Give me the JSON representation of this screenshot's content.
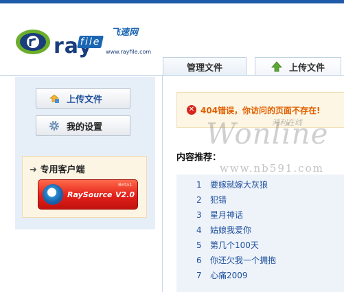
{
  "header": {
    "logo_brand": "ray",
    "logo_brand_file": "file",
    "logo_cn": "飞速网",
    "logo_url": "www.rayfile.com"
  },
  "tabs": [
    {
      "label": "管理文件"
    },
    {
      "label": "上传文件",
      "icon": "green-up-arrow-icon"
    }
  ],
  "sidebar": {
    "buttons": [
      {
        "label": "上传文件",
        "icon": "upload-icon"
      },
      {
        "label": "我的设置",
        "icon": "gear-icon"
      }
    ],
    "client": {
      "title": "专用客户端",
      "product_name": "RaySource",
      "product_version": "V2.0",
      "product_tag": "Beta1"
    }
  },
  "error": {
    "message": "404错误，你访问的页面不存在!",
    "icon": "error-x-icon",
    "color": "#e05f00"
  },
  "content": {
    "title": "内容推荐：",
    "items": [
      {
        "num": "1",
        "title": "要嫁就嫁大灰狼"
      },
      {
        "num": "2",
        "title": "犯错"
      },
      {
        "num": "3",
        "title": "星月神话"
      },
      {
        "num": "4",
        "title": "姑娘我爱你"
      },
      {
        "num": "5",
        "title": "第几个100天"
      },
      {
        "num": "6",
        "title": "你还欠我一个拥抱"
      },
      {
        "num": "7",
        "title": "心痛2009"
      }
    ]
  },
  "watermark": {
    "text": "Wonline",
    "small": "鸿利在线",
    "site": "www.nb591.com"
  },
  "colors": {
    "accent": "#1e5aa8",
    "link": "#1e4f9c"
  }
}
